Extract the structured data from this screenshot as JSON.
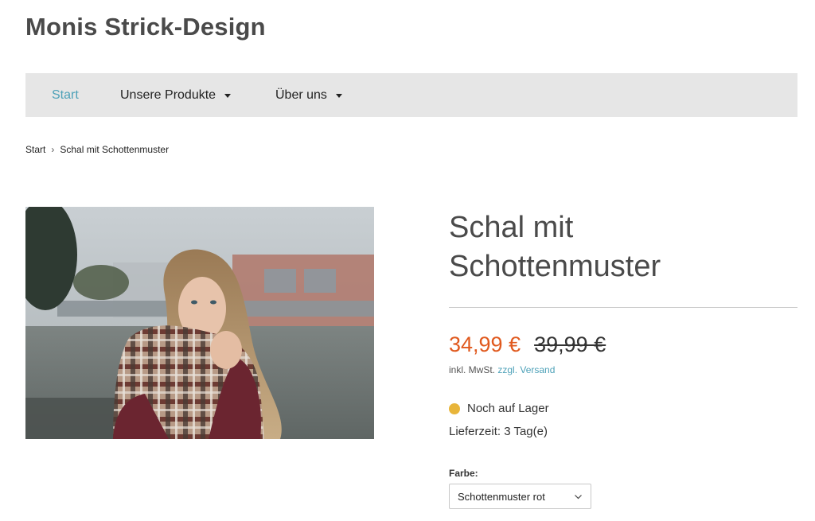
{
  "site": {
    "title": "Monis Strick-Design"
  },
  "nav": {
    "items": [
      {
        "label": "Start",
        "active": true,
        "dropdown": false
      },
      {
        "label": "Unsere Produkte",
        "active": false,
        "dropdown": true
      },
      {
        "label": "Über uns",
        "active": false,
        "dropdown": true
      }
    ]
  },
  "breadcrumb": {
    "home": "Start",
    "separator": "›",
    "current": "Schal mit Schottenmuster"
  },
  "product": {
    "title": "Schal mit Schottenmuster",
    "price": "34,99 €",
    "old_price": "39,99 €",
    "tax_prefix": "inkl. MwSt.",
    "shipping_link": "zzgl. Versand",
    "stock_status": "Noch auf Lager",
    "delivery": "Lieferzeit: 3 Tag(e)",
    "option_label": "Farbe:",
    "option_selected": "Schottenmuster rot",
    "image_icon": "product-photo"
  },
  "colors": {
    "accent": "#4da1b8",
    "price": "#e0591e",
    "stock_dot": "#e8b53a",
    "nav_bg": "#e6e6e6"
  }
}
